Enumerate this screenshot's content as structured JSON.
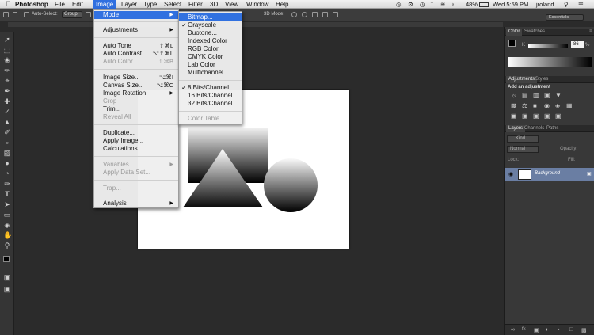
{
  "menubar": {
    "apple": "",
    "app_name": "Photoshop",
    "items": [
      "File",
      "Edit",
      "Image",
      "Layer",
      "Type",
      "Select",
      "Filter",
      "3D",
      "View",
      "Window",
      "Help"
    ],
    "battery": "48%",
    "clock": "Wed 5:59 PM",
    "user": "jroland"
  },
  "options": {
    "auto_select_label": "Auto-Select:",
    "auto_select_value": "Group",
    "mode_3d_label": "3D Mode:",
    "workspace": "Essentials"
  },
  "image_menu": {
    "items": [
      {
        "label": "Mode",
        "submenu": true,
        "highlighted": true
      },
      {
        "label": "Adjustments",
        "submenu": true
      },
      {
        "label": "Auto Tone",
        "shortcut": "⇧⌘L"
      },
      {
        "label": "Auto Contrast",
        "shortcut": "⌥⇧⌘L"
      },
      {
        "label": "Auto Color",
        "shortcut": "⇧⌘B",
        "disabled": true
      },
      {
        "label": "Image Size...",
        "shortcut": "⌥⌘I"
      },
      {
        "label": "Canvas Size...",
        "shortcut": "⌥⌘C"
      },
      {
        "label": "Image Rotation",
        "submenu": true
      },
      {
        "label": "Crop",
        "disabled": true
      },
      {
        "label": "Trim..."
      },
      {
        "label": "Reveal All",
        "disabled": true
      },
      {
        "label": "Duplicate..."
      },
      {
        "label": "Apply Image..."
      },
      {
        "label": "Calculations..."
      },
      {
        "label": "Variables",
        "submenu": true,
        "disabled": true
      },
      {
        "label": "Apply Data Set...",
        "disabled": true
      },
      {
        "label": "Trap...",
        "disabled": true
      },
      {
        "label": "Analysis",
        "submenu": true
      }
    ]
  },
  "mode_menu": {
    "items": [
      {
        "label": "Bitmap...",
        "highlighted": true
      },
      {
        "label": "Grayscale",
        "checked": true
      },
      {
        "label": "Duotone..."
      },
      {
        "label": "Indexed Color"
      },
      {
        "label": "RGB Color"
      },
      {
        "label": "CMYK Color"
      },
      {
        "label": "Lab Color"
      },
      {
        "label": "Multichannel"
      },
      {
        "label": "8 Bits/Channel",
        "checked": true
      },
      {
        "label": "16 Bits/Channel"
      },
      {
        "label": "32 Bits/Channel"
      },
      {
        "label": "Color Table...",
        "disabled": true
      }
    ]
  },
  "panels": {
    "color_tabs": [
      "Color",
      "Swatches"
    ],
    "color_value": "86",
    "color_unit": "%",
    "adjust_tabs": [
      "Adjustments",
      "Styles"
    ],
    "add_adjustment": "Add an adjustment",
    "layers_tabs": [
      "Layers",
      "Channels",
      "Paths"
    ],
    "kind_label": "Kind",
    "blend_mode": "Normal",
    "opacity_label": "Opacity:",
    "fill_label": "Fill:",
    "lock_label": "Lock:",
    "layer_name": "Background"
  },
  "colors": {
    "menu_highlight": "#3171e0",
    "layer_selected": "#6a7ea3"
  }
}
